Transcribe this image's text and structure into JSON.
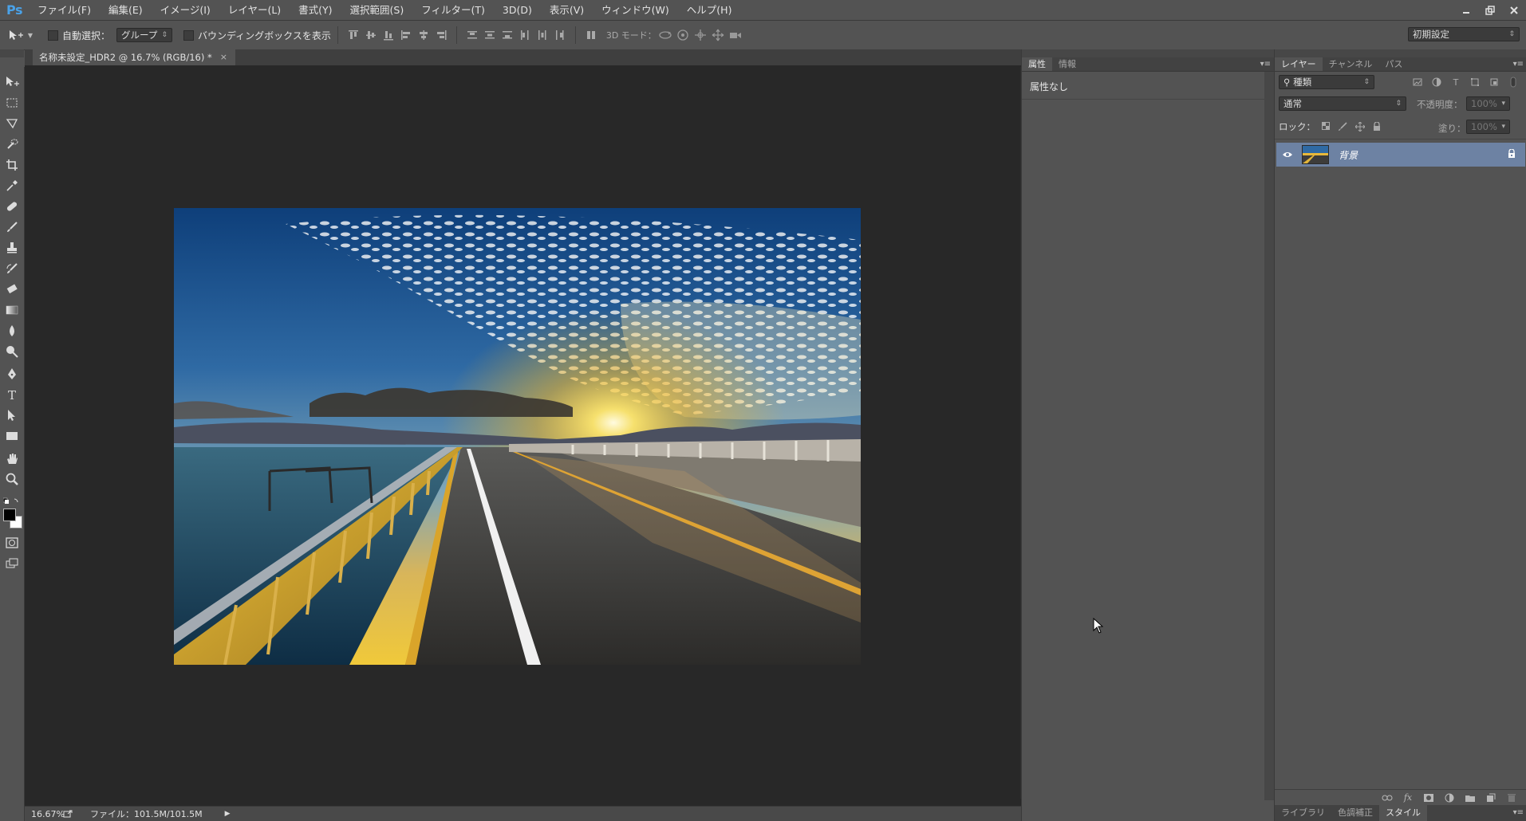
{
  "app": {
    "logo": "Ps",
    "menu": [
      "ファイル(F)",
      "編集(E)",
      "イメージ(I)",
      "レイヤー(L)",
      "書式(Y)",
      "選択範囲(S)",
      "フィルター(T)",
      "3D(D)",
      "表示(V)",
      "ウィンドウ(W)",
      "ヘルプ(H)"
    ],
    "window_controls": [
      "minimize-icon",
      "restore-icon",
      "close-icon"
    ]
  },
  "options": {
    "auto_select_label": "自動選択：",
    "auto_select_value": "グループ",
    "bbox_label": "バウンディングボックスを表示",
    "mode3d_label": "3D モード：",
    "workspace_value": "初期設定"
  },
  "tools": [
    "move-tool-icon",
    "marquee-tool-icon",
    "lasso-tool-icon",
    "quick-select-tool-icon",
    "crop-tool-icon",
    "eyedropper-tool-icon",
    "healing-brush-tool-icon",
    "brush-tool-icon",
    "clone-stamp-tool-icon",
    "history-brush-tool-icon",
    "eraser-tool-icon",
    "gradient-tool-icon",
    "blur-tool-icon",
    "dodge-tool-icon",
    "pen-tool-icon",
    "type-tool-icon",
    "path-select-tool-icon",
    "rectangle-tool-icon",
    "hand-tool-icon",
    "zoom-tool-icon"
  ],
  "document": {
    "tab_title": "名称未設定_HDR2 @ 16.7% (RGB/16) *",
    "zoom": "16.67%",
    "file_info": "ファイル：101.5M/101.5M"
  },
  "properties": {
    "tabs": [
      "属性",
      "情報"
    ],
    "body_text": "属性なし"
  },
  "layers": {
    "tabs": [
      "レイヤー",
      "チャンネル",
      "パス"
    ],
    "filter_value": "種類",
    "blend_mode": "通常",
    "opacity_label": "不透明度：",
    "opacity_value": "100%",
    "lock_label": "ロック：",
    "fill_label": "塗り：",
    "fill_value": "100%",
    "layer_name": "背景",
    "bottom_tabs": [
      "ライブラリ",
      "色調補正",
      "スタイル"
    ]
  },
  "colors": {
    "accent_blue": "#4aa2e8",
    "selected_layer": "#6d82a3",
    "canvas_bg": "#282828",
    "panel_bg": "#535353"
  }
}
